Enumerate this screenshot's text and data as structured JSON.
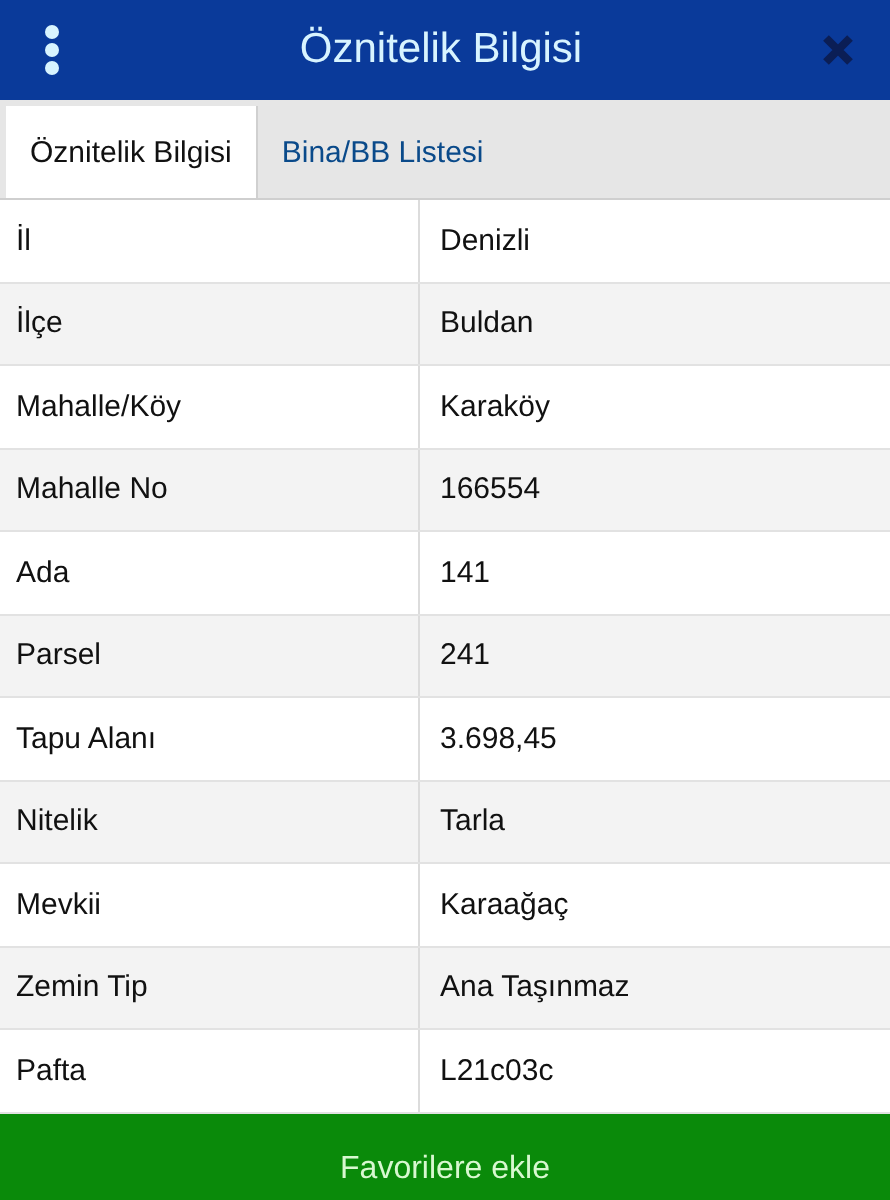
{
  "header": {
    "title": "Öznitelik Bilgisi"
  },
  "tabs": [
    {
      "label": "Öznitelik Bilgisi",
      "selected": true
    },
    {
      "label": "Bina/BB Listesi",
      "selected": false
    }
  ],
  "rows": [
    {
      "label": "İl",
      "value": "Denizli"
    },
    {
      "label": "İlçe",
      "value": "Buldan"
    },
    {
      "label": "Mahalle/Köy",
      "value": "Karaköy"
    },
    {
      "label": "Mahalle No",
      "value": "166554"
    },
    {
      "label": "Ada",
      "value": "141"
    },
    {
      "label": "Parsel",
      "value": "241"
    },
    {
      "label": "Tapu Alanı",
      "value": "3.698,45"
    },
    {
      "label": "Nitelik",
      "value": "Tarla"
    },
    {
      "label": "Mevkii",
      "value": "Karaağaç"
    },
    {
      "label": "Zemin Tip",
      "value": "Ana Taşınmaz"
    },
    {
      "label": "Pafta",
      "value": "L21c03c"
    }
  ],
  "button": {
    "label": "Favorilere ekle"
  }
}
